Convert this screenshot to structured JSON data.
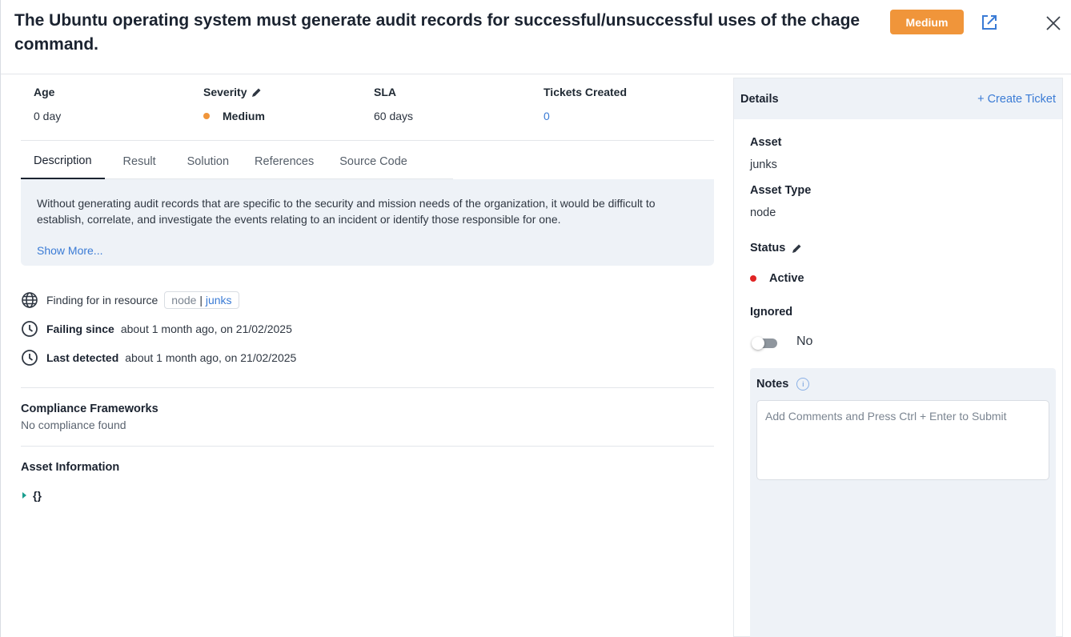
{
  "header": {
    "title": "The Ubuntu operating system must generate audit records for successful/unsuccessful uses of the chage command.",
    "severity_badge": "Medium",
    "colors": {
      "severity_badge": "#f0953a",
      "link": "#3a7bd5"
    }
  },
  "stats": {
    "age_label": "Age",
    "age_value": "0 day",
    "severity_label": "Severity",
    "severity_value": "Medium",
    "sla_label": "SLA",
    "sla_value": "60 days",
    "tickets_label": "Tickets Created",
    "tickets_value": "0"
  },
  "tabs": [
    {
      "label": "Description",
      "active": true
    },
    {
      "label": "Result"
    },
    {
      "label": "Solution"
    },
    {
      "label": "References"
    },
    {
      "label": "Source Code"
    }
  ],
  "description": {
    "text": "Without generating audit records that are specific to the security and mission needs of the organization, it would be difficult to establish, correlate, and investigate the events relating to an incident or identify those responsible for one.",
    "show_more": "Show More..."
  },
  "resource": {
    "label": "Finding for in resource",
    "type": "node",
    "separator": "|",
    "name": "junks",
    "failing_label": "Failing since",
    "failing_value": "about 1 month ago, on 21/02/2025",
    "detected_label": "Last detected",
    "detected_value": "about 1 month ago, on 21/02/2025"
  },
  "compliance": {
    "title": "Compliance Frameworks",
    "empty": "No compliance found"
  },
  "asset_info": {
    "title": "Asset Information",
    "json": "{}"
  },
  "details": {
    "title": "Details",
    "create_ticket": "+ Create Ticket",
    "asset_label": "Asset",
    "asset_value": "junks",
    "asset_type_label": "Asset Type",
    "asset_type_value": "node",
    "status_label": "Status",
    "status_value": "Active",
    "status_color": "#e02424",
    "ignored_label": "Ignored",
    "ignored_value": "No",
    "notes_label": "Notes",
    "notes_info": "i",
    "notes_placeholder": "Add Comments and Press Ctrl + Enter to Submit"
  }
}
